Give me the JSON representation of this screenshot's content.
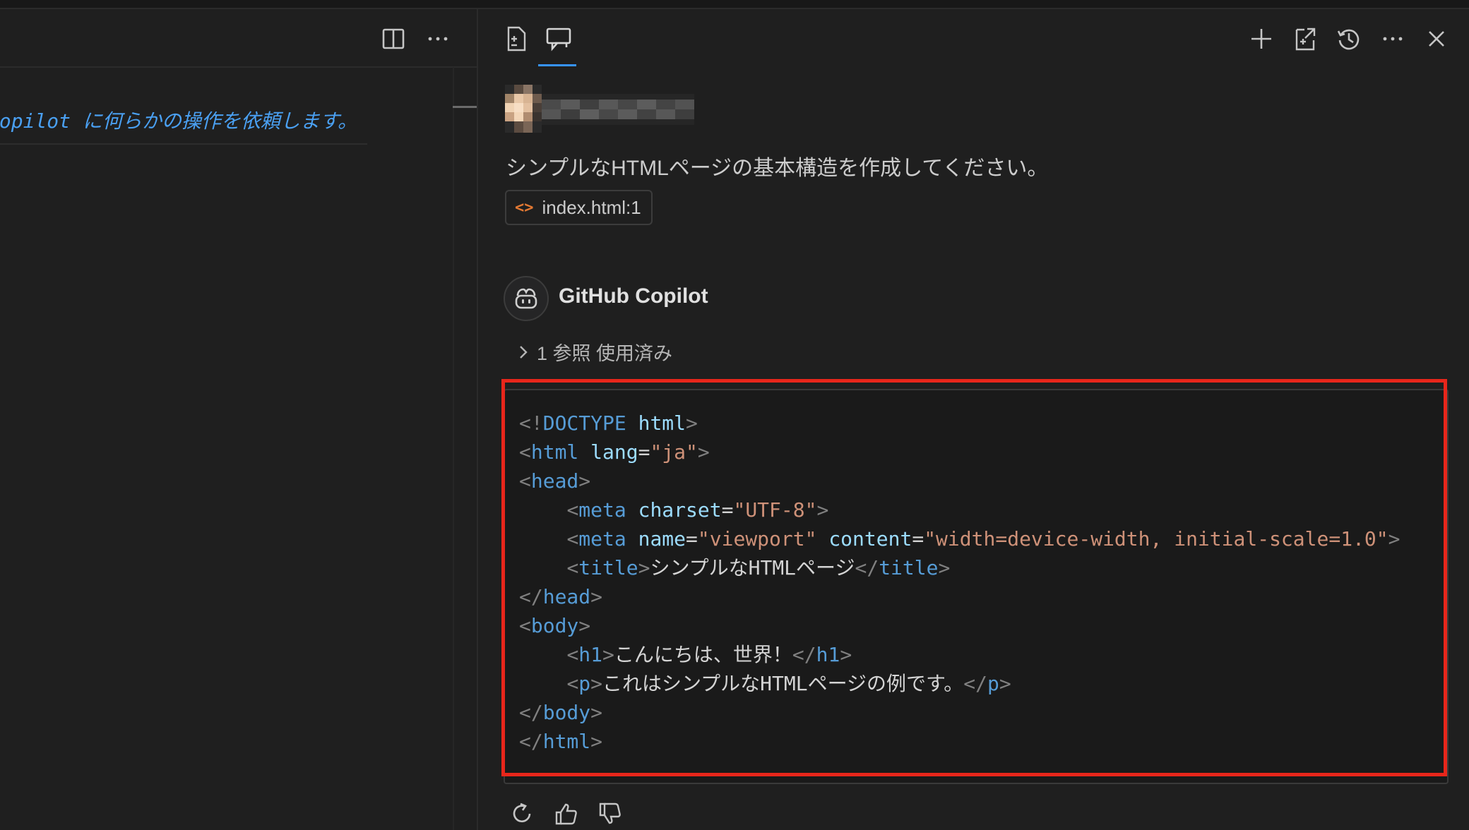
{
  "editor": {
    "hint_text": "Copilot に何らかの操作を依頼します。 /",
    "header_icons": [
      "split-editor-icon",
      "more-icon"
    ]
  },
  "chat": {
    "tabs": [
      "chat-editing-icon",
      "chat-icon"
    ],
    "actions": [
      "plus-icon",
      "open-in-editor-icon",
      "history-icon",
      "more-icon",
      "close-icon"
    ],
    "user_prompt": "シンプルなHTMLページの基本構造を作成してください。",
    "attachment": {
      "icon": "code-icon",
      "label": "index.html:1"
    },
    "assistant_name": "GitHub Copilot",
    "references_label": "1 参照 使用済み",
    "code": {
      "language": "html",
      "lines": [
        "<!DOCTYPE html>",
        "<html lang=\"ja\">",
        "<head>",
        "    <meta charset=\"UTF-8\">",
        "    <meta name=\"viewport\" content=\"width=device-width, initial-scale=1.0\">",
        "    <title>シンプルなHTMLページ</title>",
        "</head>",
        "<body>",
        "    <h1>こんにちは、世界！</h1>",
        "    <p>これはシンプルなHTMLページの例です。</p>",
        "</body>",
        "</html>"
      ]
    },
    "feedback_icons": [
      "retry-icon",
      "thumbs-up-icon",
      "thumbs-down-icon"
    ],
    "highlight_color": "#e8261b",
    "accent_color": "#3794ff"
  }
}
